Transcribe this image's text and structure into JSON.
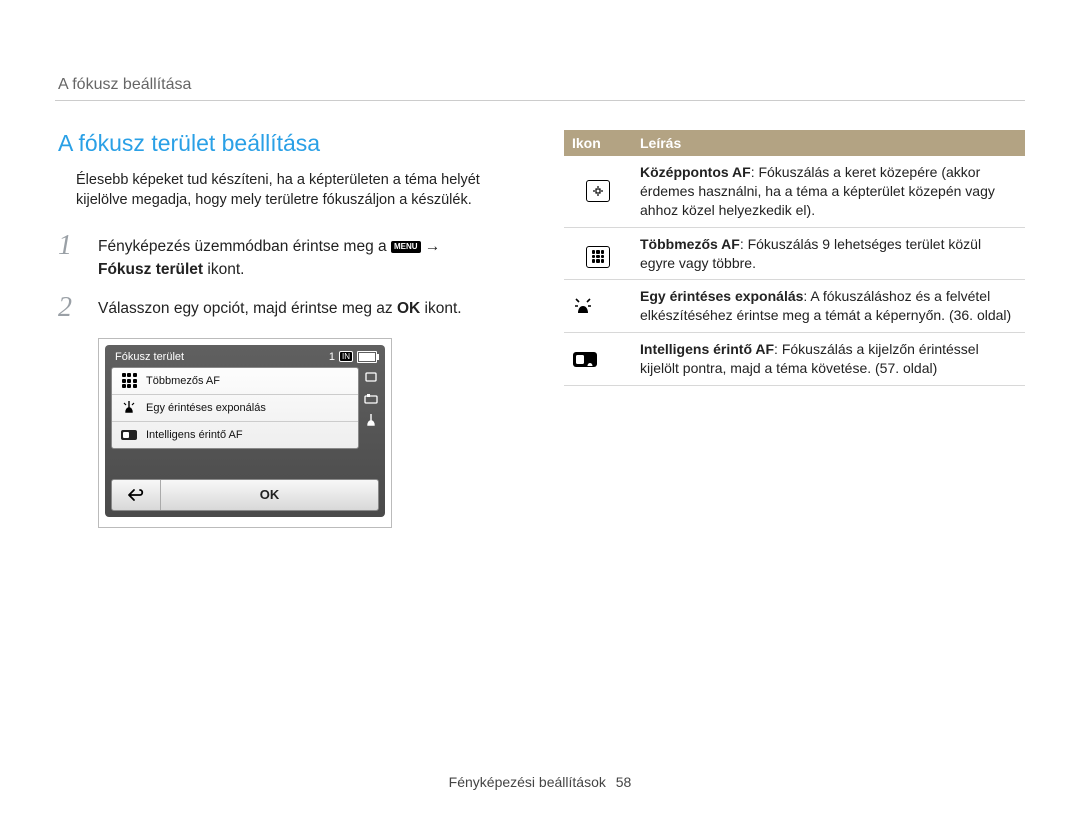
{
  "header": {
    "running_title": "A fókusz beállítása"
  },
  "left": {
    "heading": "A fókusz terület beállítása",
    "intro": "Élesebb képeket tud készíteni, ha a képterületen a téma helyét kijelölve megadja, hogy mely területre fókuszáljon a készülék.",
    "steps": [
      {
        "num": "1",
        "text_before_icon": "Fényképezés üzemmódban érintse meg a ",
        "icon_label": "MENU",
        "arrow": " →",
        "bold_text": "Fókusz terület",
        "suffix": " ikont."
      },
      {
        "num": "2",
        "text_before_icon": "Válasszon egy opciót, majd érintse meg az ",
        "icon_label": "OK",
        "suffix": " ikont."
      }
    ]
  },
  "camera": {
    "title": "Fókusz terület",
    "counter": "1",
    "in_label": "IN",
    "items": [
      "Többmezős AF",
      "Egy érintéses exponálás",
      "Intelligens érintő AF"
    ],
    "ok_label": "OK"
  },
  "table": {
    "headers": [
      "Ikon",
      "Leírás"
    ],
    "rows": [
      {
        "title": "Középpontos AF",
        "desc": ": Fókuszálás a keret közepére (akkor érdemes használni, ha a téma a képterület közepén vagy ahhoz közel helyezkedik el)."
      },
      {
        "title": "Többmezős AF",
        "desc": ": Fókuszálás 9 lehetséges terület közül egyre vagy többre."
      },
      {
        "title": "Egy érintéses exponálás",
        "desc": ": A fókuszáláshoz és a felvétel elkészítéséhez érintse meg a témát a képernyőn. (36. oldal)"
      },
      {
        "title": "Intelligens érintő AF",
        "desc": ": Fókuszálás a kijelzőn érintéssel kijelölt pontra, majd a téma követése. (57. oldal)"
      }
    ]
  },
  "footer": {
    "section": "Fényképezési beállítások",
    "page": "58"
  }
}
